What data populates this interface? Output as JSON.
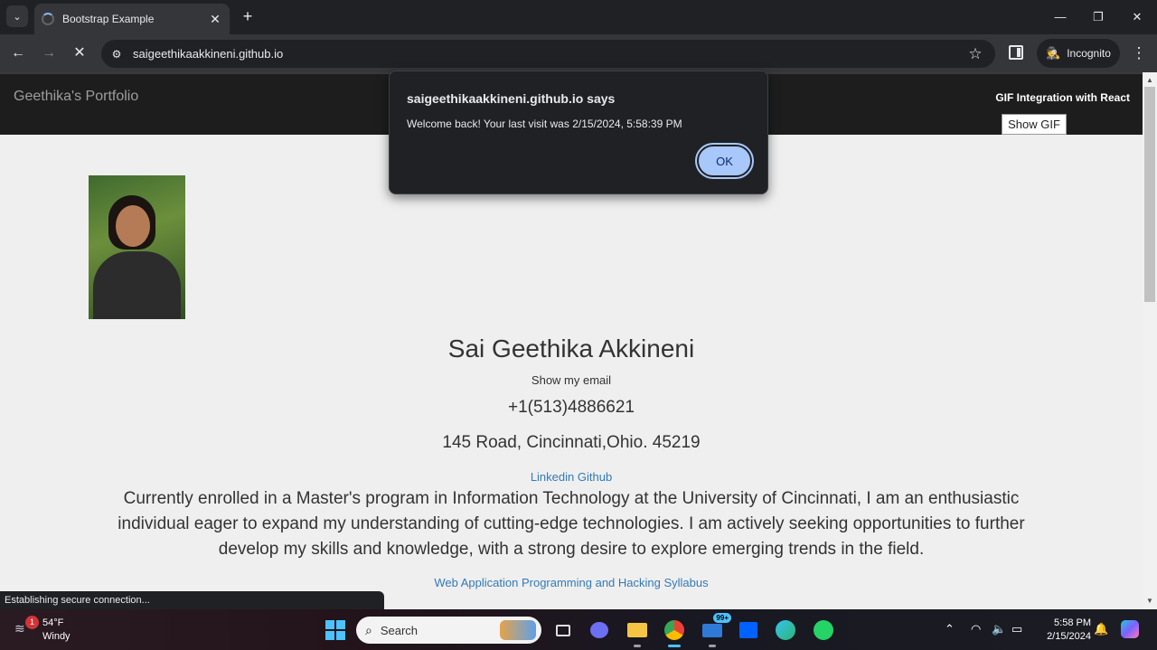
{
  "browser": {
    "tab_title": "Bootstrap Example",
    "url": "saigeethikaakkineni.github.io",
    "incognito_label": "Incognito",
    "status_text": "Establishing secure connection..."
  },
  "page": {
    "brand": "Geethika's Portfolio",
    "gif_title": "GIF Integration with React",
    "gif_button": "Show GIF",
    "name": "Sai Geethika Akkineni",
    "email_toggle": "Show my email",
    "phone": "+1(513)4886621",
    "address": "145 Road, Cincinnati,Ohio. 45219",
    "link_linkedin": "Linkedin",
    "link_github": "Github",
    "bio": "Currently enrolled in a Master's program in Information Technology at the University of Cincinnati, I am an enthusiastic individual eager to expand my understanding of cutting-edge technologies. I am actively seeking opportunities to further develop my skills and knowledge, with a strong desire to explore emerging trends in the field.",
    "syllabus_link": "Web Application Programming and Hacking Syllabus"
  },
  "dialog": {
    "title": "saigeethikaakkineni.github.io says",
    "message": "Welcome back! Your last visit was 2/15/2024, 5:58:39 PM",
    "ok_label": "OK"
  },
  "taskbar": {
    "weather_badge": "1",
    "temperature": "54°F",
    "condition": "Windy",
    "search_placeholder": "Search",
    "mail_badge": "99+",
    "time": "5:58 PM",
    "date": "2/15/2024"
  },
  "colors": {
    "accent_link": "#337ab7",
    "dialog_button": "#a8c7fa",
    "navbar_bg": "#1d1d1d"
  }
}
